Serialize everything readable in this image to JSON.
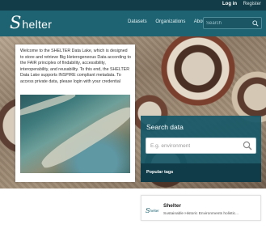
{
  "account": {
    "login": "Log in",
    "register": "Register"
  },
  "logo": {
    "first_letter": "S",
    "rest": "helter"
  },
  "nav": {
    "items": [
      "Datasets",
      "Organizations",
      "About"
    ]
  },
  "site_search": {
    "placeholder": "Search",
    "icon": "search-icon"
  },
  "intro": {
    "text": "Welcome to the SHELTER Data Lake, which is designed to store and retrieve Big Heterogeneous Data according to the FAIR principles of findability, accessibility, interoperability, and reusability. To this end, the SHELTER Data Lake supports INSPIRE compliant metadata. To access private data, please login with your credential"
  },
  "search_data": {
    "title": "Search data",
    "placeholder": "E.g. environment",
    "icon": "search-icon",
    "popular_tags": "Popular tags"
  },
  "showcase": {
    "logo_first": "S",
    "logo_rest": "helter",
    "name": "Shelter",
    "description": "Sustainable Historic Environments holistic..."
  },
  "colors": {
    "account_bar": "#123c47",
    "masthead": "#1d6372",
    "search_panel": "#165868",
    "tags_bar": "#0f3c48"
  }
}
